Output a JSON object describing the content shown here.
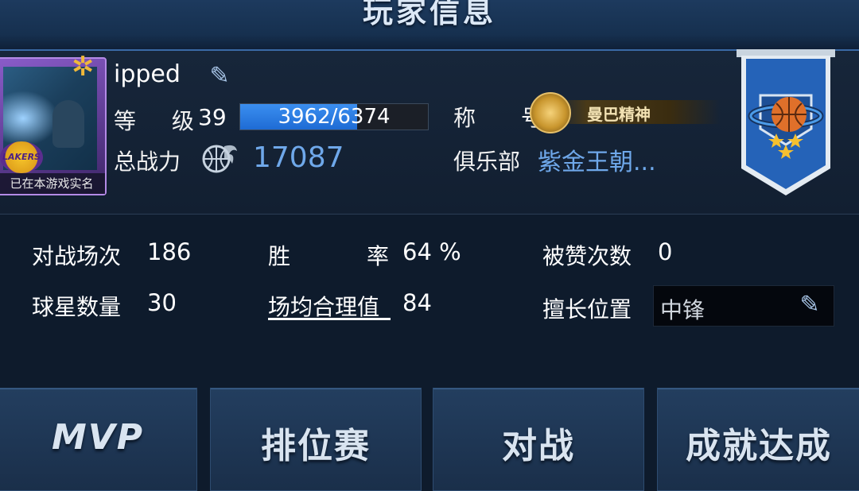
{
  "header": {
    "title": "玩家信息"
  },
  "player": {
    "avatar_caption": "已在本游戏实名",
    "avatar_badge": "LAKERS",
    "name": "ipped",
    "level_label": "等  级",
    "level": "39",
    "exp_text": "3962/6374",
    "exp_progress": 0.6216,
    "honor_label": "称  号",
    "honor_title": "曼巴精神",
    "power_label": "总战力",
    "power": "17087",
    "club_label": "俱乐部",
    "club": "紫金王朝..."
  },
  "stats": {
    "matches_label": "对战场次",
    "matches": "186",
    "winrate_label_a": "胜",
    "winrate_label_b": "率",
    "winrate": "64 %",
    "likes_label": "被赞次数",
    "likes": "0",
    "stars_label": "球星数量",
    "stars": "30",
    "avg_label": "场均合理值",
    "avg": "84",
    "position_label": "擅长位置",
    "position": "中锋"
  },
  "tabs": [
    {
      "label": "MVP"
    },
    {
      "label": "排位赛"
    },
    {
      "label": "对战"
    },
    {
      "label": "成就达成"
    }
  ],
  "colors": {
    "accent_blue": "#6fa8ea",
    "exp_bar": "#3b8ff0",
    "banner_blue": "#2563b8"
  },
  "icons": {
    "edit": "pencil-icon",
    "power": "basketball-fire-icon",
    "honor": "gold-basketball-coin-icon",
    "banner": "basketball-banner-icon"
  }
}
